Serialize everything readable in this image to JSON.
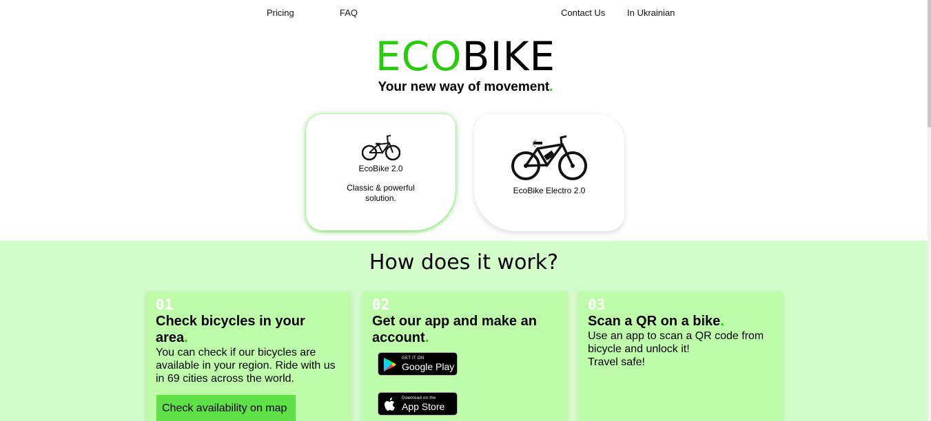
{
  "nav": {
    "pricing": "Pricing",
    "faq": "FAQ",
    "contact": "Contact Us",
    "language": "In Ukrainian"
  },
  "logo": {
    "part1": "ECO",
    "part2": "BIKE"
  },
  "tagline": {
    "text": "Your new way of movement",
    "dot": "."
  },
  "products": [
    {
      "name": "EcoBike 2.0",
      "description": "Classic & powerful solution.",
      "icon": "bmx-bike-icon"
    },
    {
      "name": "EcoBike Electro 2.0",
      "description": "",
      "icon": "electric-bike-icon"
    }
  ],
  "how": {
    "title": "How does it work?",
    "steps": [
      {
        "number": "01",
        "title": "Check bicycles in your area",
        "dot": ".",
        "text": "You can check if our bicycles are available in your region. Ride with us in 69 cities across the world.",
        "button": "Check availability on map"
      },
      {
        "number": "02",
        "title": "Get our app and make an account",
        "dot": ".",
        "google_small": "GET IT ON",
        "google_big": "Google Play",
        "apple_small": "Download on the",
        "apple_big": "App Store"
      },
      {
        "number": "03",
        "title": "Scan a QR on a bike",
        "dot": ".",
        "text_line1": "Use an app to scan a QR code from bicycle and unlock it!",
        "text_line2": "Travel safe!"
      }
    ]
  },
  "colors": {
    "accent": "#27cc0a",
    "section_bg": "#d4fcca",
    "card_bg": "#befca9",
    "button_bg": "#5fe148"
  }
}
